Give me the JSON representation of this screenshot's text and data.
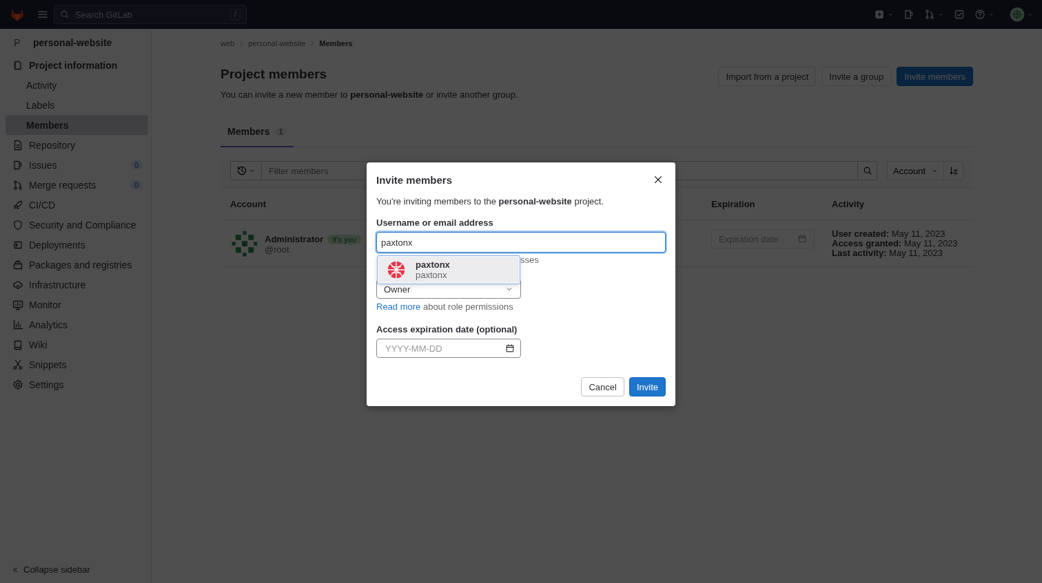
{
  "topbar": {
    "search": {
      "placeholder": "Search GitLab",
      "shortcut": "/"
    }
  },
  "sidebar": {
    "project": {
      "letter": "P",
      "name": "personal-website"
    },
    "items": [
      {
        "label": "Project information",
        "selected": false,
        "expanded": true,
        "children": [
          {
            "label": "Activity",
            "selected": false
          },
          {
            "label": "Labels",
            "selected": false
          },
          {
            "label": "Members",
            "selected": true
          }
        ]
      },
      {
        "label": "Repository",
        "selected": false
      },
      {
        "label": "Issues",
        "selected": false,
        "badge": "0"
      },
      {
        "label": "Merge requests",
        "selected": false,
        "badge": "0"
      },
      {
        "label": "CI/CD",
        "selected": false
      },
      {
        "label": "Security and Compliance",
        "selected": false
      },
      {
        "label": "Deployments",
        "selected": false
      },
      {
        "label": "Packages and registries",
        "selected": false
      },
      {
        "label": "Infrastructure",
        "selected": false
      },
      {
        "label": "Monitor",
        "selected": false
      },
      {
        "label": "Analytics",
        "selected": false
      },
      {
        "label": "Wiki",
        "selected": false
      },
      {
        "label": "Snippets",
        "selected": false
      },
      {
        "label": "Settings",
        "selected": false
      }
    ],
    "collapse": "Collapse sidebar"
  },
  "breadcrumbs": [
    {
      "label": "web",
      "current": false
    },
    {
      "label": "personal-website",
      "current": false
    },
    {
      "label": "Members",
      "current": true
    }
  ],
  "page": {
    "title": "Project members",
    "description": "You can invite a new member to **personal-website** or invite another group.",
    "buttons": [
      {
        "label": "Import from a project",
        "kind": "default"
      },
      {
        "label": "Invite a group",
        "kind": "default"
      },
      {
        "label": "Invite members",
        "kind": "primary"
      }
    ]
  },
  "tabs": [
    {
      "label": "Members",
      "count": "1",
      "selected": true
    }
  ],
  "filter": {
    "placeholder": "Filter members",
    "sort": "Account"
  },
  "table": {
    "columns": [
      "Account",
      "Expiration",
      "Activity"
    ],
    "rows": [
      {
        "name": "Administrator",
        "badge": "It's you",
        "username": "@root",
        "expiration_placeholder": "Expiration date",
        "activity": [
          "**User created:** May 11, 2023",
          "**Access granted:** May 11, 2023",
          "**Last activity:** May 11, 2023"
        ]
      }
    ]
  },
  "modal": {
    "title": "Invite members",
    "intro": "You're inviting members to the **personal-website** project.",
    "username_label": "Username or email address",
    "username_value": "paxtonx",
    "hint": "sses",
    "suggestions": [
      {
        "name": "paxtonx",
        "username": "paxtonx",
        "selected": true
      }
    ],
    "role": "Owner",
    "read_more_link": "Read more",
    "read_more_text": "about role permissions",
    "date_label": "Access expiration date (optional)",
    "date_placeholder": "YYYY-MM-DD",
    "buttons": [
      {
        "label": "Cancel",
        "kind": "default"
      },
      {
        "label": "Invite",
        "kind": "primary"
      }
    ]
  }
}
